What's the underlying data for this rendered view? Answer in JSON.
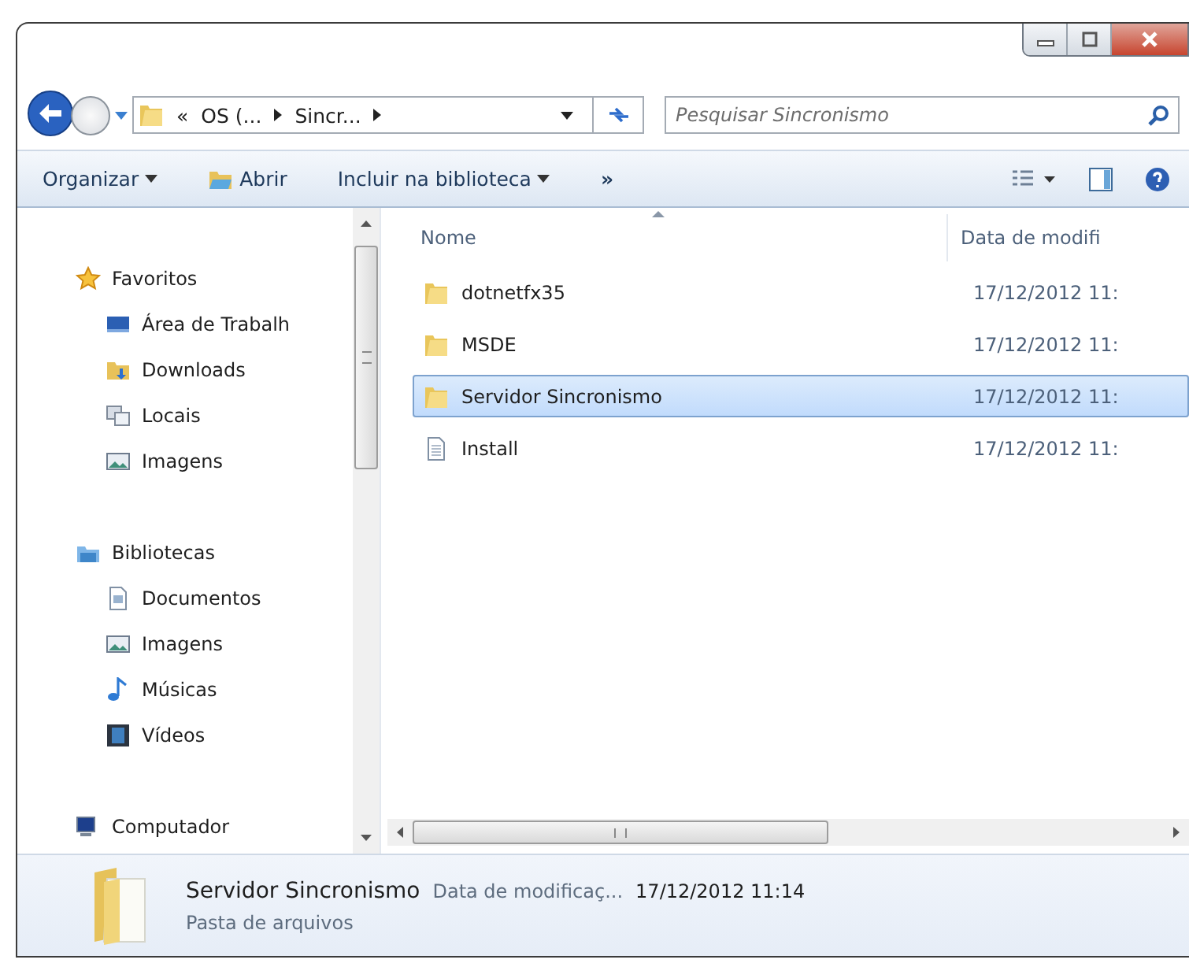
{
  "address": {
    "overflow": "«",
    "segments": [
      "OS (...",
      "Sincr..."
    ]
  },
  "search": {
    "placeholder": "Pesquisar Sincronismo"
  },
  "toolbar": {
    "items": [
      {
        "kind": "menu",
        "label": "Organizar"
      },
      {
        "kind": "open",
        "label": "Abrir"
      },
      {
        "kind": "menu",
        "label": "Incluir na biblioteca"
      },
      {
        "kind": "more",
        "label": "»"
      }
    ]
  },
  "nav": {
    "groups": [
      {
        "kind": "star",
        "label": "Favoritos",
        "children": [
          {
            "kind": "desktop",
            "label": "Área de Trabalh"
          },
          {
            "kind": "downloads",
            "label": "Downloads"
          },
          {
            "kind": "places",
            "label": "Locais"
          },
          {
            "kind": "pictures",
            "label": "Imagens"
          }
        ]
      },
      {
        "kind": "library",
        "label": "Bibliotecas",
        "children": [
          {
            "kind": "documents",
            "label": "Documentos"
          },
          {
            "kind": "pictures",
            "label": "Imagens"
          },
          {
            "kind": "music",
            "label": "Músicas"
          },
          {
            "kind": "videos",
            "label": "Vídeos"
          }
        ]
      },
      {
        "kind": "computer",
        "label": "Computador"
      }
    ]
  },
  "files": {
    "columns": [
      "Nome",
      "Data de modifi"
    ],
    "rows": [
      {
        "kind": "folder",
        "name": "dotnetfx35",
        "date": "17/12/2012 11:",
        "selected": false
      },
      {
        "kind": "folder",
        "name": "MSDE",
        "date": "17/12/2012 11:",
        "selected": false
      },
      {
        "kind": "folder",
        "name": "Servidor Sincronismo",
        "date": "17/12/2012 11:",
        "selected": true
      },
      {
        "kind": "file",
        "name": "Install",
        "date": "17/12/2012 11:",
        "selected": false
      }
    ]
  },
  "details": {
    "name": "Servidor Sincronismo",
    "field_label": "Data de modificaç...",
    "field_value": "17/12/2012 11:14",
    "type": "Pasta de arquivos"
  }
}
